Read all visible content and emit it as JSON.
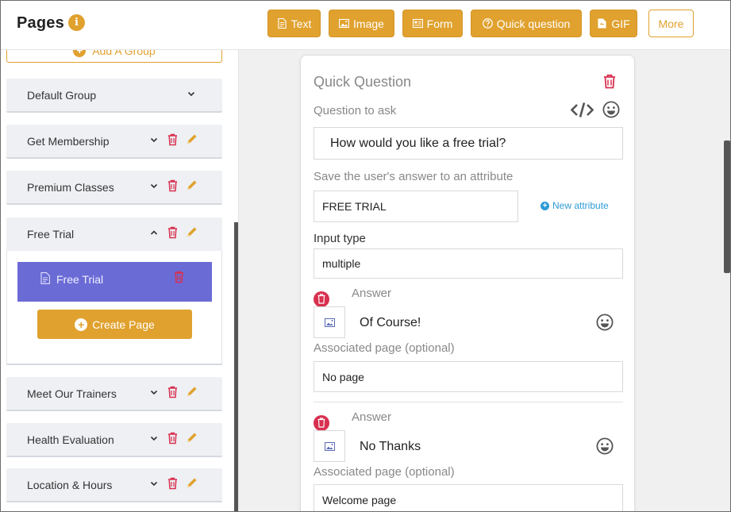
{
  "header": {
    "title": "Pages",
    "toolbar": [
      {
        "label": "Text",
        "icon": "document-icon"
      },
      {
        "label": "Image",
        "icon": "image-icon"
      },
      {
        "label": "Form",
        "icon": "form-icon"
      },
      {
        "label": "Quick question",
        "icon": "question-circle-icon"
      },
      {
        "label": "GIF",
        "icon": "gif-file-icon"
      },
      {
        "label": "More",
        "icon": ""
      }
    ]
  },
  "sidebar": {
    "add_group_label": "Add A Group",
    "groups": [
      {
        "label": "Default Group"
      },
      {
        "label": "Get Membership"
      },
      {
        "label": "Premium Classes"
      },
      {
        "label": "Free Trial",
        "expanded": true
      },
      {
        "label": "Meet Our Trainers"
      },
      {
        "label": "Health Evaluation"
      },
      {
        "label": "Location & Hours"
      }
    ],
    "open_group": {
      "page_label": "Free Trial",
      "create_page_label": "Create Page"
    }
  },
  "quick_question": {
    "title": "Quick Question",
    "question_label": "Question to ask",
    "question_value": "How would you like a free trial?",
    "save_label": "Save the user's answer to an attribute",
    "attribute_value": "FREE TRIAL",
    "new_attribute_label": "New attribute",
    "input_type_label": "Input type",
    "input_type_value": "multiple",
    "answers": [
      {
        "label": "Answer",
        "text": "Of Course!",
        "page_label": "Associated page (optional)",
        "page_value": "No page"
      },
      {
        "label": "Answer",
        "text": "No Thanks",
        "page_label": "Associated page (optional)",
        "page_value": "Welcome page"
      }
    ]
  },
  "colors": {
    "accent": "#e0a12e",
    "selected_page": "#6b6bd6",
    "danger": "#d8304f",
    "link": "#2d9bd6"
  }
}
